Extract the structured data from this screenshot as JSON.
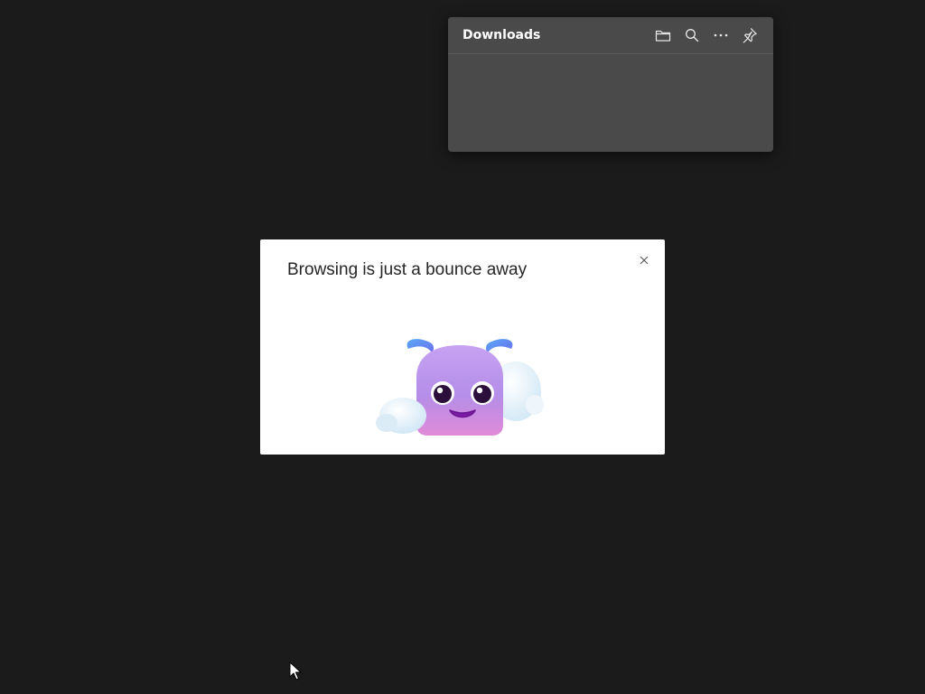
{
  "downloads": {
    "title": "Downloads",
    "buttons": [
      {
        "name": "open-folder",
        "icon": "folder-icon"
      },
      {
        "name": "search",
        "icon": "search-icon"
      },
      {
        "name": "more-options",
        "icon": "more-icon"
      },
      {
        "name": "pin",
        "icon": "pin-icon"
      }
    ]
  },
  "dialog": {
    "title": "Browsing is just a bounce away",
    "close_icon": "close-icon",
    "illustration": "bounce-mascot"
  },
  "colors": {
    "background": "#1b1b1b",
    "panel": "#4a4a4a",
    "dialog": "#ffffff",
    "mascot_body": "#b48ee8",
    "mascot_antenna": "#5b8ef0"
  }
}
